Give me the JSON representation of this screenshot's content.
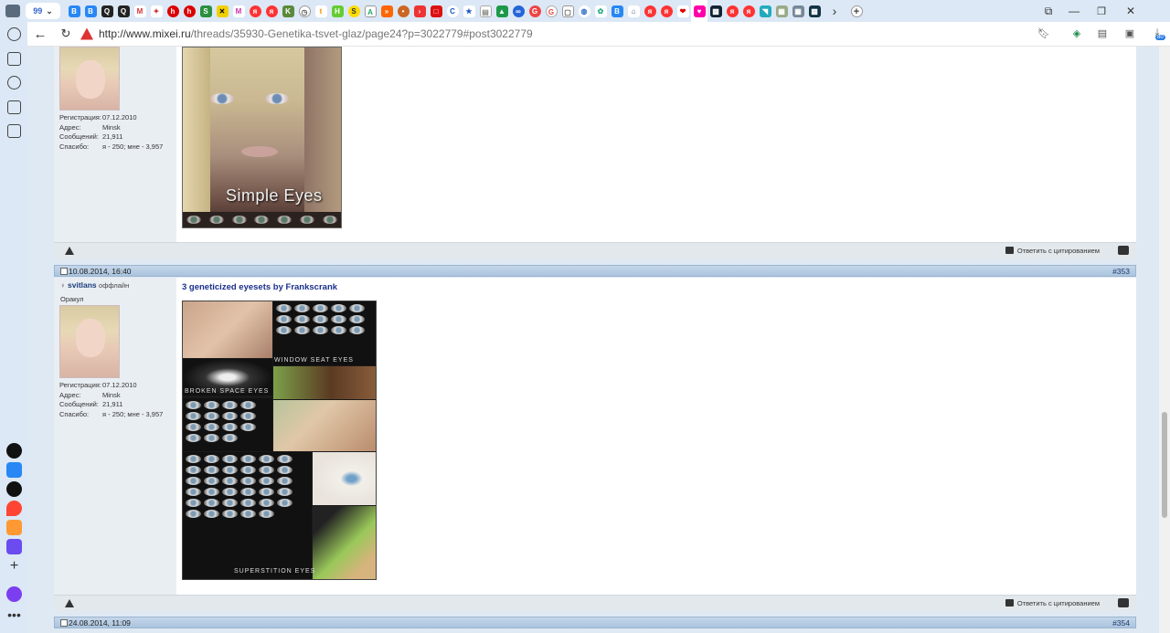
{
  "browser": {
    "active_tab_badge": "99",
    "url_host": "http://www.mixei.ru",
    "url_path": "/threads/35930-Genetika-tsvet-glaz/page24?p=3022779#post3022779",
    "download_badge": "80",
    "colors": {
      "tabbar": "#dce8f5",
      "accent": "#3366cc"
    }
  },
  "post_prev": {
    "registration_label": "Регистрация:",
    "registration": "07.12.2010",
    "address_label": "Адрес:",
    "address": "Minsk",
    "messages_label": "Сообщений:",
    "messages": "21,911",
    "thanks_label": "Спасибо:",
    "thanks": "я - 250; мне - 3,957",
    "image_caption": "Simple Eyes",
    "quote_label": "Ответить с цитированием"
  },
  "post_353": {
    "date": "10.08.2014, 16:40",
    "number": "#353",
    "username": "svitlans",
    "status": "оффлайн",
    "rank": "Оракул",
    "registration_label": "Регистрация:",
    "registration": "07.12.2010",
    "address_label": "Адрес:",
    "address": "Minsk",
    "messages_label": "Сообщений:",
    "messages": "21,911",
    "thanks_label": "Спасибо:",
    "thanks": "я - 250; мне - 3,957",
    "title": "3 geneticized eyesets by Frankscrank",
    "collage_labels": [
      "WINDOW SEAT EYES",
      "BROKEN SPACE EYES",
      "SUPERSTITION EYES"
    ],
    "quote_label": "Ответить с цитированием"
  },
  "post_354": {
    "date": "24.08.2014, 11:09",
    "number": "#354"
  }
}
